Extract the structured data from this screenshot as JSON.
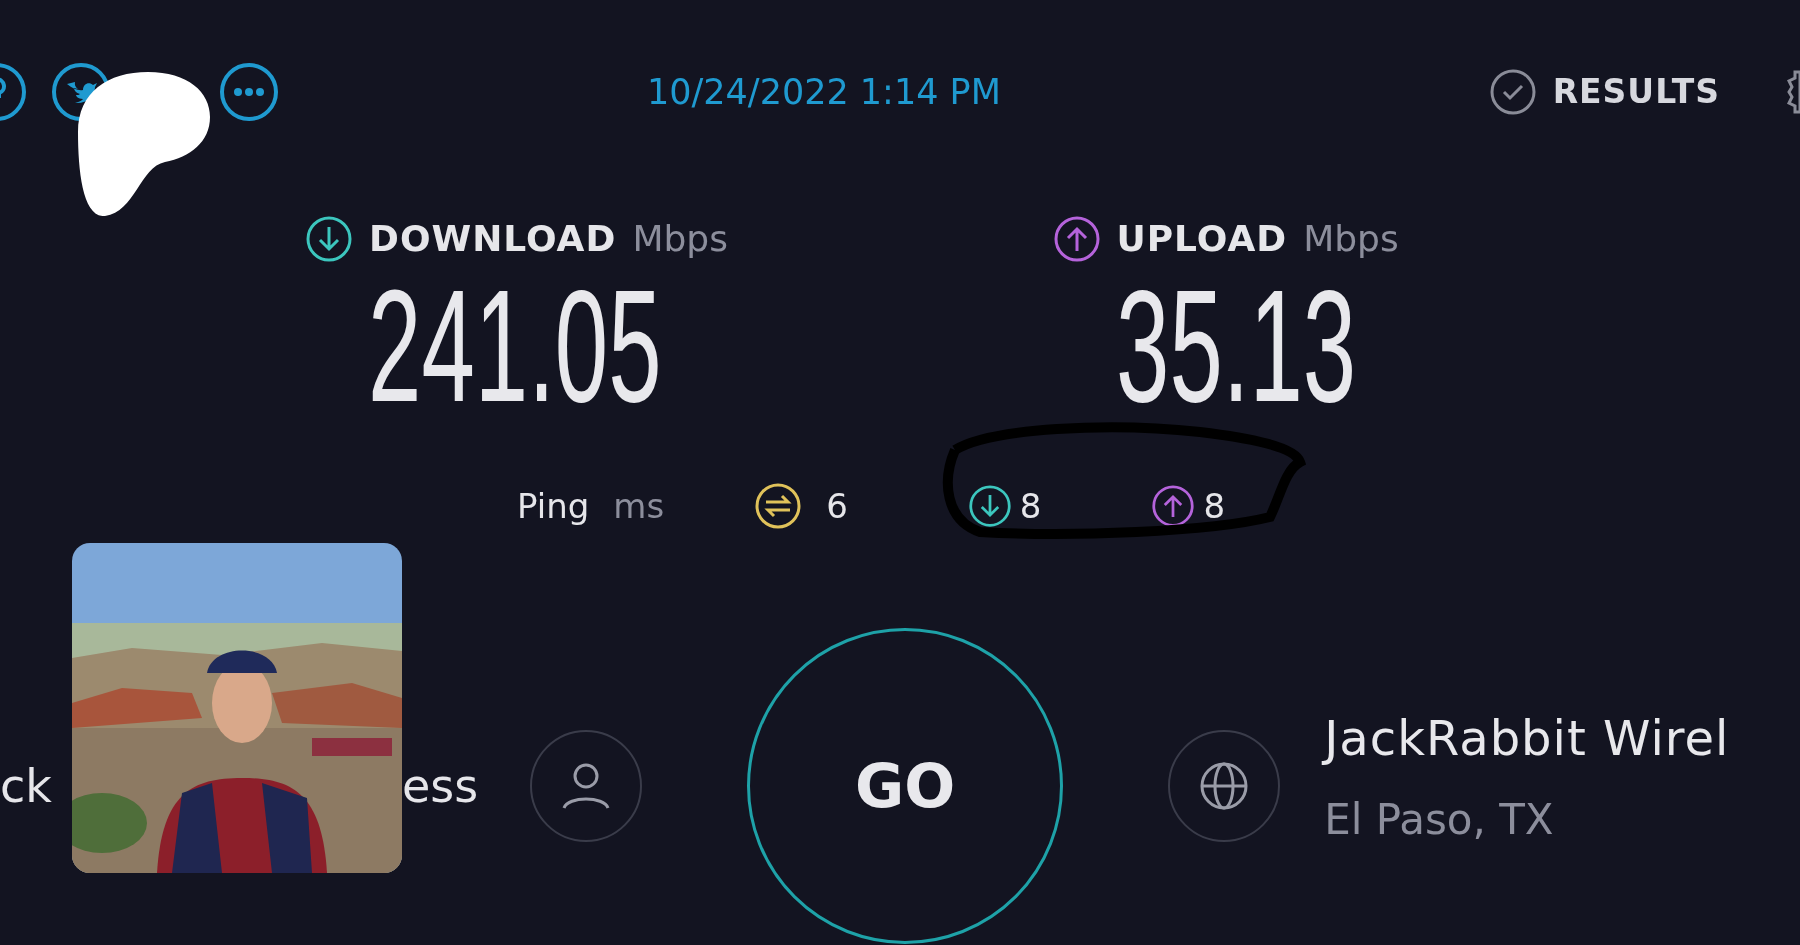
{
  "date": "10/24/2022 1:14 PM",
  "results_link": "RESULTS",
  "metrics": [
    {
      "kind": "download",
      "label": "DOWNLOAD",
      "unit": "Mbps",
      "value": "241.05"
    },
    {
      "kind": "upload",
      "label": "UPLOAD",
      "unit": "Mbps",
      "value": "35.13"
    }
  ],
  "ping": {
    "label": "Ping",
    "unit": "ms",
    "idle": "6",
    "download": "8",
    "upload": "8"
  },
  "provider": {
    "name_parts": [
      "ck",
      "ess"
    ]
  },
  "go_button": "GO",
  "server": {
    "name": "JackRabbit Wirel",
    "location": "El Paso, TX"
  }
}
